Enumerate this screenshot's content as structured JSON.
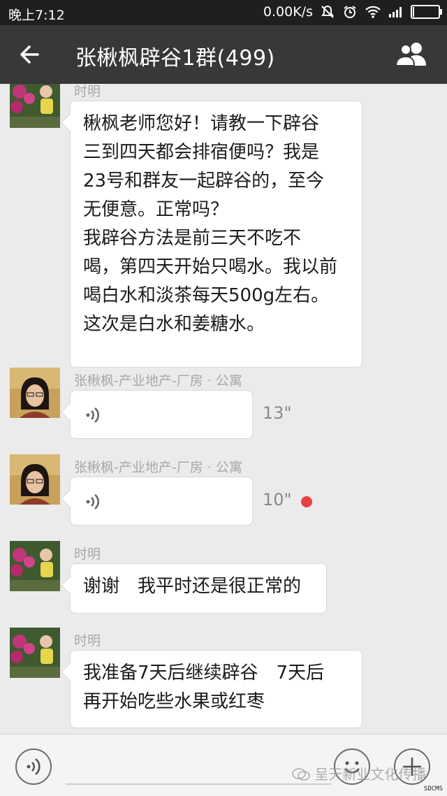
{
  "status_bar": {
    "time": "晚上7:12",
    "net_speed": "0.00K/s"
  },
  "header": {
    "title": "张楸枫辟谷1群(499)"
  },
  "messages": [
    {
      "sender": "时明",
      "type": "text",
      "lines": [
        "楸枫老师您好！请教一下辟谷",
        "三到四天都会排宿便吗？我是",
        "23号和群友一起辟谷的，至今",
        "无便意。正常吗？",
        "我辟谷方法是前三天不吃不",
        "喝，第四天开始只喝水。我以前",
        "喝白水和淡茶每天500g左右。",
        "这次是白水和姜糖水。"
      ]
    },
    {
      "sender": "张楸枫-产业地产-厂房 · 公寓",
      "type": "voice",
      "duration": "13\""
    },
    {
      "sender": "张楸枫-产业地产-厂房 · 公寓",
      "type": "voice",
      "duration": "10\"",
      "unread": true
    },
    {
      "sender": "时明",
      "type": "text",
      "lines": [
        "谢谢　我平时还是很正常的"
      ]
    },
    {
      "sender": "时明",
      "type": "text",
      "lines": [
        "我准备7天后继续辟谷　7天后",
        "再开始吃些水果或红枣"
      ]
    }
  ],
  "watermark": "呈天新业文化传播",
  "corner_mark": "SDCMS",
  "colors": {
    "header_bg": "#383838",
    "chat_bg": "#ebebeb",
    "unread_dot": "#e64340"
  }
}
